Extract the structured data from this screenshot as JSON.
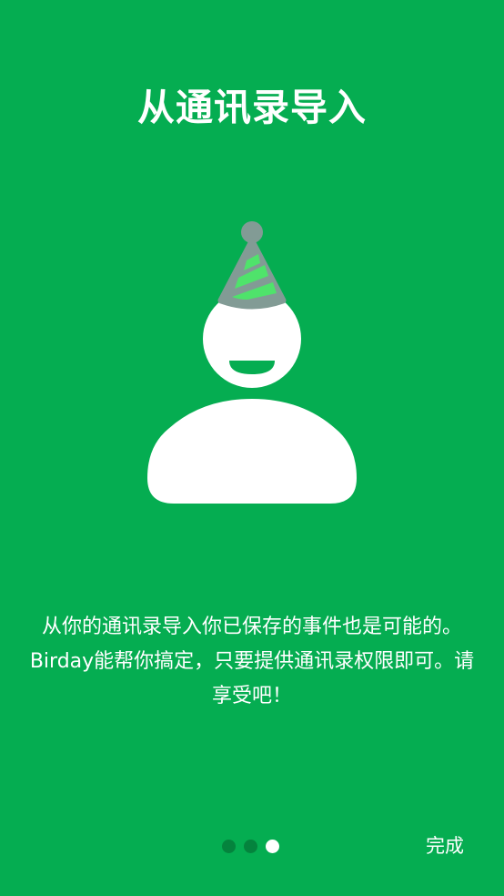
{
  "screen": {
    "title": "从通讯录导入",
    "description": "从你的通讯录导入你已保存的事件也是可能的。Birday能帮你搞定，只要提供通讯录权限即可。请享受吧！",
    "done_label": "完成"
  },
  "pager": {
    "total_pages": 3,
    "current_page": 3
  },
  "colors": {
    "background": "#05ad51",
    "hat_gray": "#829b95",
    "hat_stripe": "#4fe36b",
    "figure": "#ffffff",
    "inactive_dot": "#04833d"
  },
  "icons": {
    "illustration": "party-person-icon"
  }
}
